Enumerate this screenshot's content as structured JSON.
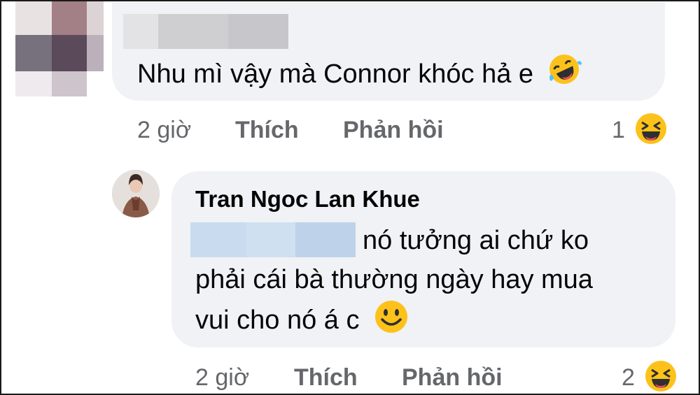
{
  "comment1": {
    "text": "Nhu mì vậy mà Connor khóc hả e",
    "time": "2 giờ",
    "like_label": "Thích",
    "reply_label": "Phản hồi",
    "reaction_count": "1",
    "reaction_icon": "laughing-emoji-icon"
  },
  "comment2": {
    "author": "Tran Ngoc Lan Khue",
    "line1": "nó tưởng ai chứ ko",
    "line2": "phải cái bà thường ngày hay mua",
    "line3": "vui cho nó á c",
    "time": "2 giờ",
    "like_label": "Thích",
    "reply_label": "Phản hồi",
    "reaction_count": "2",
    "reaction_icon": "laughing-emoji-icon"
  },
  "colors": {
    "bubble": "#f0f2f5",
    "meta_text": "#65676b",
    "text": "#050505",
    "emoji_yellow": "#fcc21b"
  }
}
